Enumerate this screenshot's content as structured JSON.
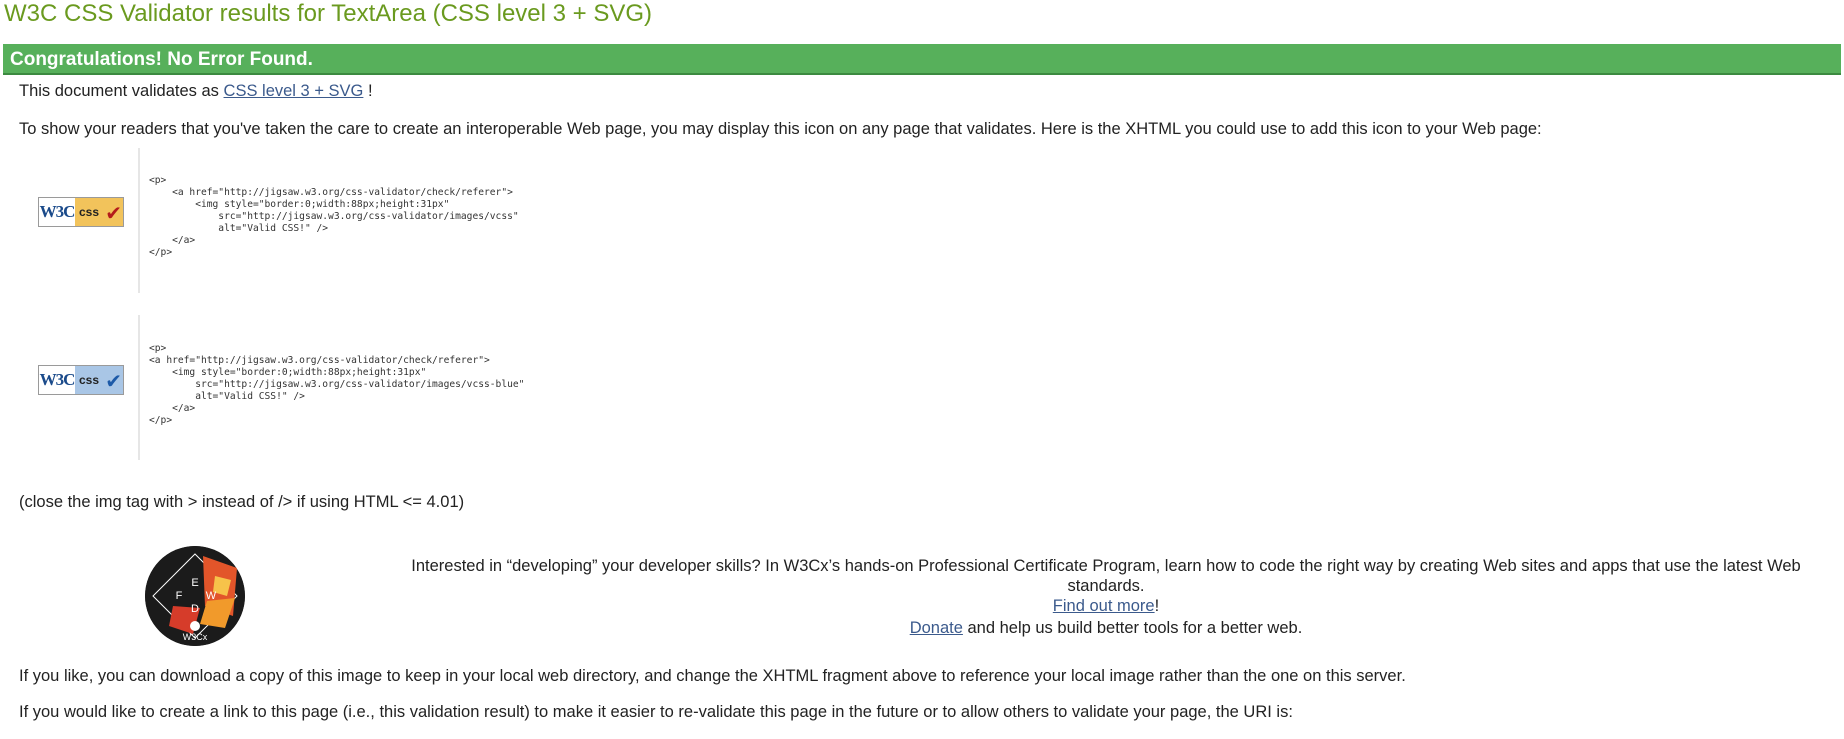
{
  "page": {
    "title": "W3C CSS Validator results for TextArea (CSS level 3 + SVG)"
  },
  "result": {
    "congrats": "Congratulations! No Error Found.",
    "validates_prefix": "This document validates as ",
    "validates_link": "CSS level 3 + SVG",
    "validates_suffix": " !",
    "show_icon_text": "To show your readers that you've taken the care to create an interoperable Web page, you may display this icon on any page that validates. Here is the XHTML you could use to add this icon to your Web page:"
  },
  "badges": [
    {
      "w3c_text": "W3C",
      "css_text": "css",
      "check_symbol": "✔",
      "color": "#f2c35b",
      "code": "<p>\n    <a href=\"http://jigsaw.w3.org/css-validator/check/referer\">\n        <img style=\"border:0;width:88px;height:31px\"\n            src=\"http://jigsaw.w3.org/css-validator/images/vcss\"\n            alt=\"Valid CSS!\" />\n    </a>\n</p>"
    },
    {
      "w3c_text": "W3C",
      "css_text": "css",
      "check_symbol": "✔",
      "color": "#a9c6e6",
      "code": "<p>\n<a href=\"http://jigsaw.w3.org/css-validator/check/referer\">\n    <img style=\"border:0;width:88px;height:31px\"\n        src=\"http://jigsaw.w3.org/css-validator/images/vcss-blue\"\n        alt=\"Valid CSS!\" />\n    </a>\n</p>"
    }
  ],
  "notes": {
    "close_tag": "(close the img tag with > instead of /> if using HTML <= 4.01)",
    "download": "If you like, you can download a copy of this image to keep in your local web directory, and change the XHTML fragment above to reference your local image rather than the one on this server.",
    "link_page": "If you would like to create a link to this page (i.e., this validation result) to make it easier to re-validate this page in the future or to allow others to validate your page, the URI is:"
  },
  "promo": {
    "text": "Interested in “developing” your developer skills? In W3Cx’s hands-on Professional Certificate Program, learn how to code the right way by creating Web sites and apps that use the latest Web standards.",
    "find_out_more": "Find out more",
    "find_out_more_suffix": "!",
    "donate_link": "Donate",
    "donate_suffix": " and help us build better tools for a better web.",
    "logo_icon": "front-end-web-developer-logo-icon",
    "logo_text": "W3Cx"
  },
  "colors": {
    "title": "#6a9a1f",
    "congrats_bg": "#57b05b",
    "link": "#3b5a8c"
  }
}
